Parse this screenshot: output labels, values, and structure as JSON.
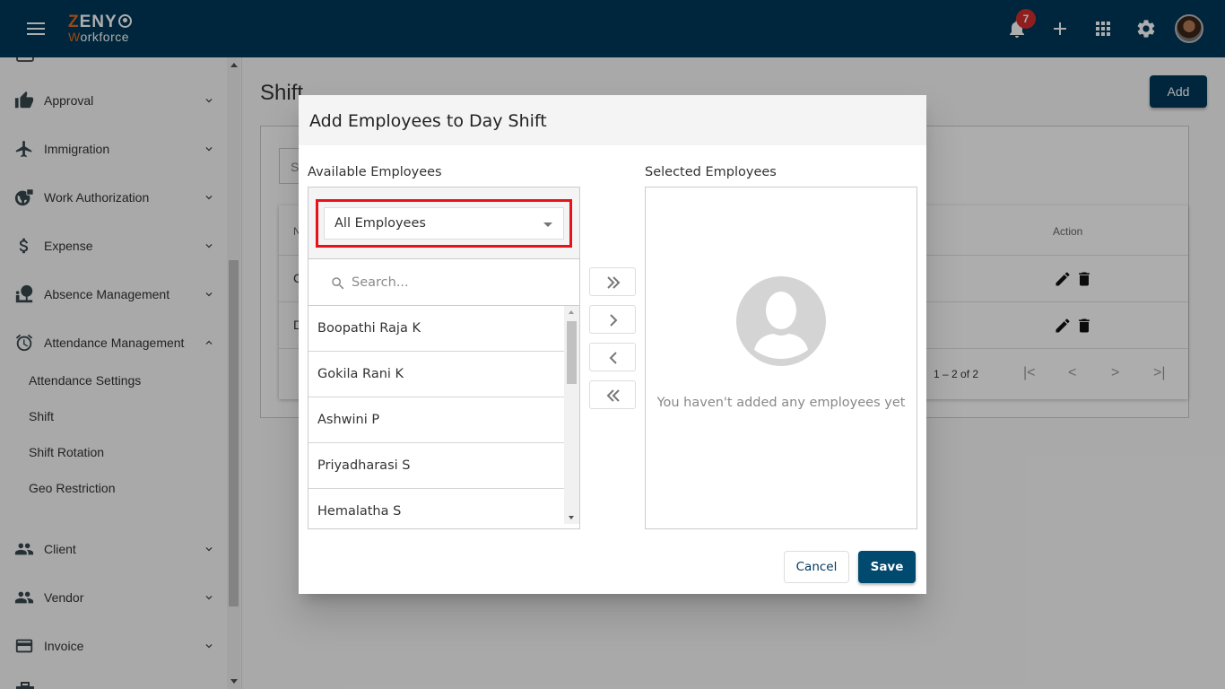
{
  "app": {
    "logo_line1_first": "Z",
    "logo_line1_rest": "ENY",
    "logo_line2_first": "W",
    "logo_line2_rest": "orkforce",
    "brand_color": "#00385a",
    "accent_color": "#e36a1f"
  },
  "topbar": {
    "notification_count": "7",
    "icons": [
      "menu-icon",
      "bell-icon",
      "plus-icon",
      "apps-grid-icon",
      "gear-icon",
      "user-avatar"
    ]
  },
  "sidebar": {
    "items": [
      {
        "label": "Approval",
        "icon": "thumb-up-icon",
        "expanded": false
      },
      {
        "label": "Immigration",
        "icon": "airplane-icon",
        "expanded": false
      },
      {
        "label": "Work Authorization",
        "icon": "globe-lock-icon",
        "expanded": false
      },
      {
        "label": "Expense",
        "icon": "dollar-icon",
        "expanded": false
      },
      {
        "label": "Absence Management",
        "icon": "absence-icon",
        "expanded": false
      },
      {
        "label": "Attendance Management",
        "icon": "alarm-clock-icon",
        "expanded": true
      },
      {
        "label": "Client",
        "icon": "people-icon",
        "expanded": false
      },
      {
        "label": "Vendor",
        "icon": "people-icon",
        "expanded": false
      },
      {
        "label": "Invoice",
        "icon": "credit-card-icon",
        "expanded": false
      }
    ],
    "sub_items": [
      "Attendance Settings",
      "Shift",
      "Shift Rotation",
      "Geo Restriction"
    ]
  },
  "main": {
    "page_title": "Shift",
    "add_label": "Add",
    "search_placeholder_partial": "S",
    "table": {
      "header_partial": "N",
      "action_header": "Action",
      "rows": [
        {
          "first_char": "C"
        },
        {
          "first_char": "D"
        }
      ],
      "pagination": "1 – 2 of 2"
    }
  },
  "dialog": {
    "title": "Add Employees to Day Shift",
    "available_label": "Available Employees",
    "selected_label": "Selected Employees",
    "filter_value": "All Employees",
    "search_placeholder": "Search...",
    "employees": [
      "Boopathi Raja K",
      "Gokila Rani K",
      "Ashwini P",
      "Priyadharasi S",
      "Hemalatha S"
    ],
    "empty_message": "You haven't added any employees yet",
    "cancel_label": "Cancel",
    "save_label": "Save",
    "highlight_color": "#e8131a"
  }
}
